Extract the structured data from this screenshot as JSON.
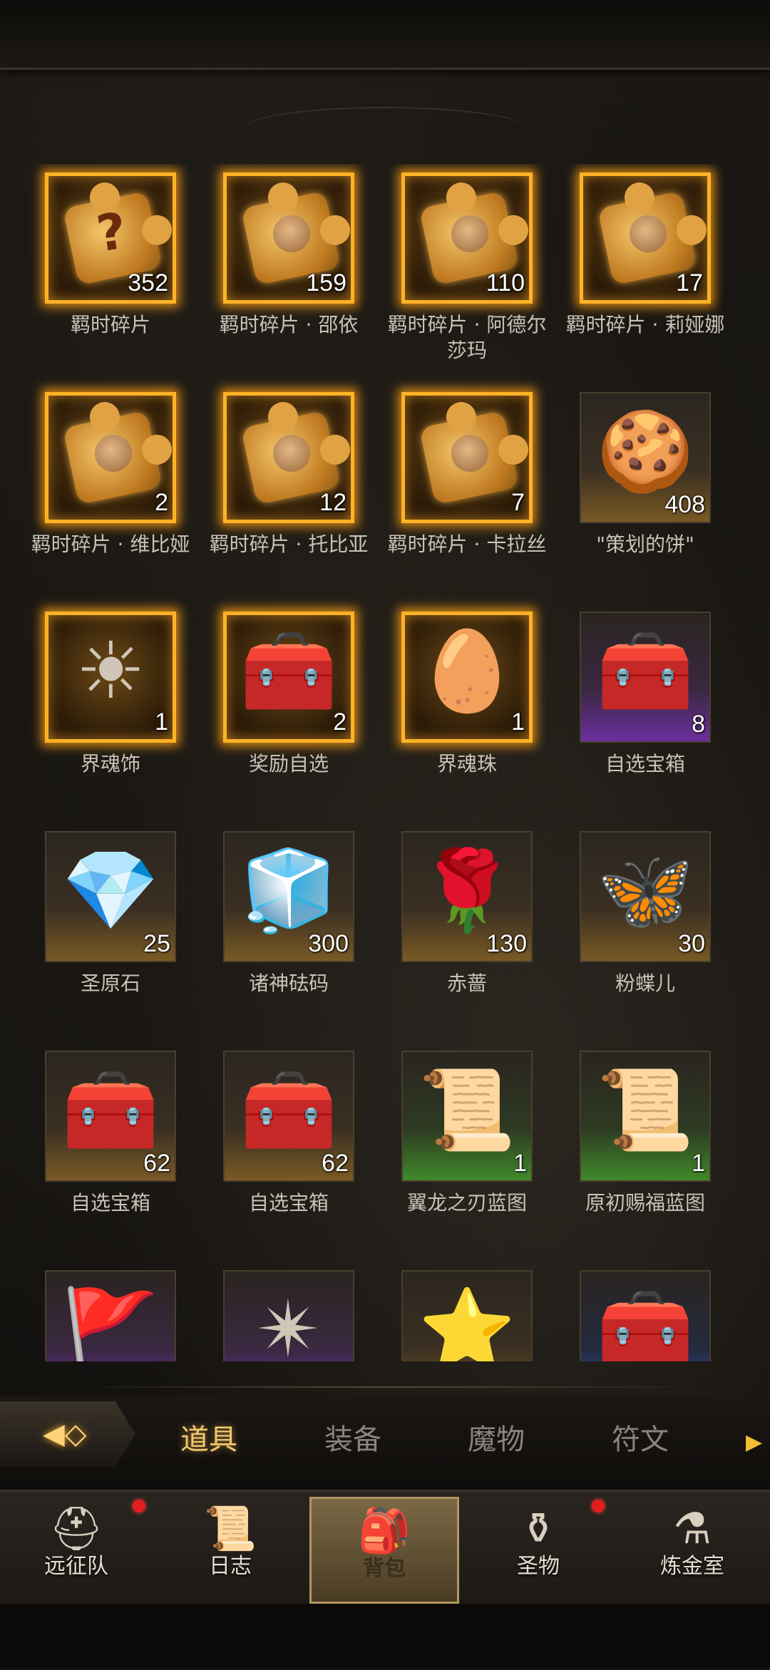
{
  "inventory": {
    "items": [
      {
        "name": "羁时碎片",
        "count": "352",
        "art": "puzzle-question",
        "frame": "gold"
      },
      {
        "name": "羁时碎片 · 邵依",
        "count": "159",
        "art": "puzzle-portrait",
        "frame": "gold"
      },
      {
        "name": "羁时碎片 · 阿德尔莎玛",
        "count": "110",
        "art": "puzzle-portrait",
        "frame": "gold"
      },
      {
        "name": "羁时碎片 · 莉娅娜",
        "count": "17",
        "art": "puzzle-portrait",
        "frame": "gold"
      },
      {
        "name": "羁时碎片 · 维比娅",
        "count": "2",
        "art": "puzzle-portrait",
        "frame": "gold"
      },
      {
        "name": "羁时碎片 · 托比亚",
        "count": "12",
        "art": "puzzle-portrait",
        "frame": "gold"
      },
      {
        "name": "羁时碎片 · 卡拉丝",
        "count": "7",
        "art": "puzzle-portrait",
        "frame": "gold"
      },
      {
        "name": "\"策划的饼\"",
        "count": "408",
        "art": "cookie",
        "frame": "plain"
      },
      {
        "name": "界魂饰",
        "count": "1",
        "art": "sun-emblem",
        "frame": "gold"
      },
      {
        "name": "奖励自选",
        "count": "2",
        "art": "chest",
        "frame": "gold"
      },
      {
        "name": "界魂珠",
        "count": "1",
        "art": "orb",
        "frame": "gold"
      },
      {
        "name": "自选宝箱",
        "count": "8",
        "art": "chest",
        "frame": "purple"
      },
      {
        "name": "圣原石",
        "count": "25",
        "art": "ruby",
        "frame": "plain"
      },
      {
        "name": "诸神砝码",
        "count": "300",
        "art": "cube",
        "frame": "plain"
      },
      {
        "name": "赤蔷",
        "count": "130",
        "art": "rose",
        "frame": "plain"
      },
      {
        "name": "粉蝶儿",
        "count": "30",
        "art": "butterfly",
        "frame": "plain"
      },
      {
        "name": "自选宝箱",
        "count": "62",
        "art": "chest",
        "frame": "plain"
      },
      {
        "name": "自选宝箱",
        "count": "62",
        "art": "chest",
        "frame": "plain"
      },
      {
        "name": "翼龙之刃蓝图",
        "count": "1",
        "art": "scroll",
        "frame": "green"
      },
      {
        "name": "原初赐福蓝图",
        "count": "1",
        "art": "scroll",
        "frame": "green"
      },
      {
        "name": "",
        "count": "",
        "art": "banner",
        "frame": "purple"
      },
      {
        "name": "",
        "count": "",
        "art": "energy",
        "frame": "purple"
      },
      {
        "name": "",
        "count": "",
        "art": "star-crystal",
        "frame": "plain"
      },
      {
        "name": "",
        "count": "",
        "art": "chest",
        "frame": "blue"
      }
    ]
  },
  "tabs": {
    "items": [
      "道具",
      "装备",
      "魔物",
      "符文"
    ],
    "active": 0
  },
  "nav": {
    "items": [
      {
        "label": "远征队",
        "icon": "viking-helmet-icon",
        "badge": true
      },
      {
        "label": "日志",
        "icon": "journal-icon",
        "badge": false
      },
      {
        "label": "背包",
        "icon": "backpack-icon",
        "badge": false
      },
      {
        "label": "圣物",
        "icon": "relic-icon",
        "badge": true
      },
      {
        "label": "炼金室",
        "icon": "alchemy-icon",
        "badge": false
      }
    ],
    "active": 2
  },
  "colors": {
    "accent": "#f3c970",
    "gold_frame": "#ffb226",
    "badge": "#e01e1e"
  }
}
